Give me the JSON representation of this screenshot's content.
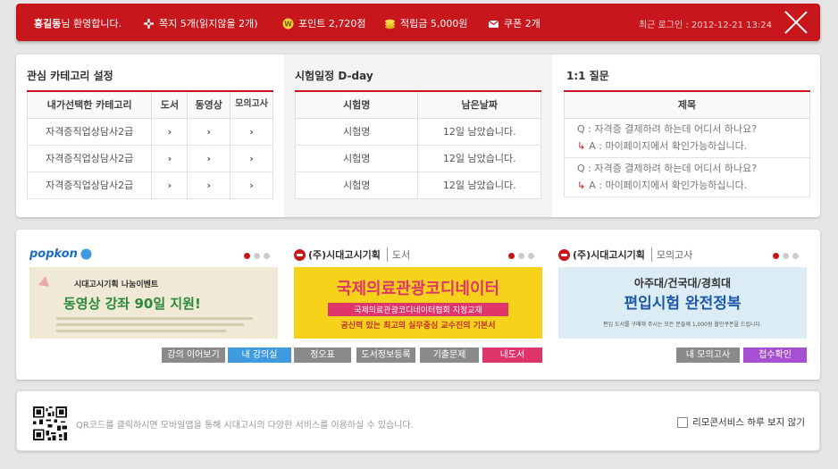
{
  "topbar": {
    "user": "홍길동",
    "greeting_suffix": "님 환영합니다.",
    "note_label": "쪽지 5개(읽지않을 2개)",
    "point_label": "포인트 2,720점",
    "reserve_label": "적립금 5,000원",
    "coupon_label": "쿠폰 2개",
    "last_login": "최근 로그인 : 2012-12-21 13:24"
  },
  "category": {
    "title": "관심 카테고리 설정",
    "headers": [
      "내가선택한 카테고리",
      "도서",
      "동영상",
      "모의고사"
    ],
    "rows": [
      {
        "name": "자격증직업상담사2급",
        "c1": "›",
        "c2": "›",
        "c3": "›"
      },
      {
        "name": "자격증직업상담사2급",
        "c1": "›",
        "c2": "›",
        "c3": "›"
      },
      {
        "name": "자격증직업상담사2급",
        "c1": "›",
        "c2": "›",
        "c3": "›"
      }
    ]
  },
  "dday": {
    "title": "시험일정 D-day",
    "headers": [
      "시험명",
      "남은날짜"
    ],
    "rows": [
      {
        "name": "시험명",
        "left": "12일 남았습니다."
      },
      {
        "name": "시험명",
        "left": "12일 남았습니다."
      },
      {
        "name": "시험명",
        "left": "12일 남았습니다."
      }
    ]
  },
  "qna": {
    "title": "1:1 질문",
    "header": "제목",
    "items": [
      {
        "q": "Q : 자격증 결제하려 하는데 어디서 하나요?",
        "a": "A : 마이페이지에서 확인가능하십니다."
      },
      {
        "q": "Q : 자격증 결제하려 하는데 어디서 하나요?",
        "a": "A : 마이페이지에서 확인가능하십니다."
      }
    ]
  },
  "banners": {
    "popkon": {
      "logo": "popkon",
      "line1": "시대고시기획 나눔이벤트",
      "line2": "동영상 강좌 90일 지원!",
      "buttons": [
        "강의 이어보기",
        "내 강의실"
      ]
    },
    "book": {
      "brand": "(주)시대고시기획",
      "sub": "도서",
      "line1": "국제의료관광코디네이터",
      "line2": "국제의료관광코디네이터협회 지정교재",
      "line3": "공신력 있는 최고의 실무중심 교수진의 기본서",
      "buttons": [
        "정오표",
        "도서정보등록",
        "기출문제",
        "내도서"
      ]
    },
    "mock": {
      "brand": "(주)시대고시기획",
      "sub": "모의고사",
      "line1": "아주대/건국대/경희대",
      "line2": "편입시험 완전정복",
      "line3": "편입 도서를 구매해 주시는 모든 분들께 1,000원 할인쿠폰을 드립니다.",
      "buttons": [
        "내 모의고사",
        "접수확인"
      ]
    }
  },
  "bottom": {
    "text": "QR코드를 클릭하시면 모바일앱을 통해 시대고시의 다양한 서비스를 이용하실 수 있습니다.",
    "nomore": "리모콘서비스 하루 보지 않기"
  }
}
